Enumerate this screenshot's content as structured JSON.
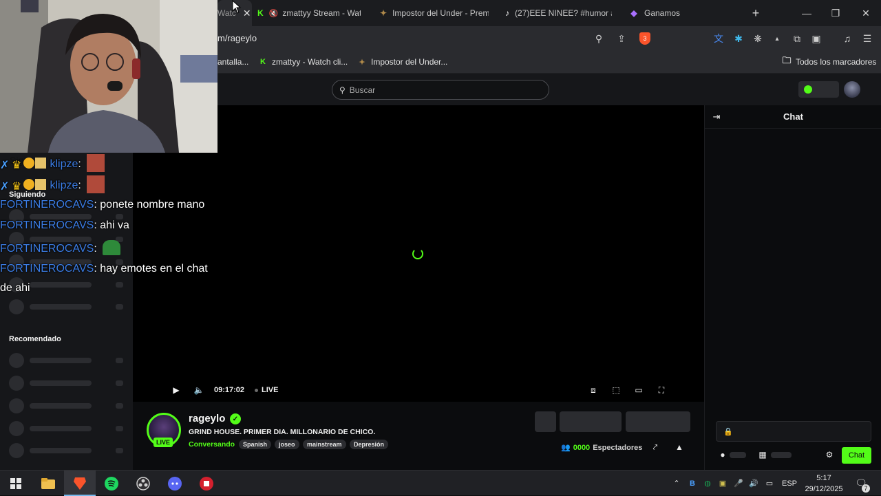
{
  "browser": {
    "tabs": [
      {
        "label": "Watc",
        "icon": "kick-icon"
      },
      {
        "label": "zmattyy Stream - Watc",
        "icon": "kick-icon"
      },
      {
        "label": "Impostor del Under - Prem",
        "icon": "game-icon"
      },
      {
        "label": "(27)EEE NINEE? #humor #",
        "icon": "tiktok-icon"
      },
      {
        "label": "Ganamos",
        "icon": "twitch-icon"
      }
    ],
    "new_tab": "+",
    "url": "m/rageylo",
    "bookmarks": [
      {
        "label": "antalla...",
        "icon": "page-icon"
      },
      {
        "label": "zmattyy - Watch cli...",
        "icon": "kick-icon"
      },
      {
        "label": "Impostor del Under...",
        "icon": "game-icon"
      }
    ],
    "all_bookmarks": "Todos los marcadores",
    "brave_badge": "3"
  },
  "kick": {
    "search_placeholder": "Buscar",
    "sidebar": {
      "following_heading": "Siguiendo",
      "recommended_heading": "Recomendado"
    },
    "player": {
      "time": "09:17:02",
      "live_label": "LIVE"
    },
    "channel": {
      "name": "rageylo",
      "live_badge": "LIVE",
      "title": "GRIND HOUSE. PRIMER DIA. MILLONARIO DE CHICO.",
      "category": "Conversando",
      "tags": [
        "Spanish",
        "joseo",
        "mainstream",
        "Depresión"
      ],
      "viewers": "0000",
      "viewers_label": "Espectadores"
    },
    "chat": {
      "title": "Chat",
      "send_label": "Chat"
    }
  },
  "overlay_chat": [
    {
      "user": "klipze",
      "sep": ":",
      "text": "",
      "has_emote": true
    },
    {
      "user": "klipze",
      "sep": ":",
      "text": "",
      "has_emote": true
    },
    {
      "user": "FORTINEROCAVS",
      "sep": ":",
      "text": " ponete nombre mano"
    },
    {
      "user": "FORTINEROCAVS",
      "sep": ":",
      "text": " ahi va"
    },
    {
      "user": "FORTINEROCAVS",
      "sep": ":",
      "text": "",
      "has_emote": true
    },
    {
      "user": "FORTINEROCAVS",
      "sep": ":",
      "text": " hay emotes en el chat"
    },
    {
      "user": "",
      "sep": "",
      "text": "de ahi"
    }
  ],
  "overlay_partial": "Sigue",
  "taskbar": {
    "apps": [
      "start-icon",
      "file-explorer-icon",
      "brave-icon",
      "spotify-icon",
      "obs-icon",
      "discord-icon",
      "app-icon"
    ],
    "language": "ESP",
    "time": "5:17",
    "date": "29/12/2025",
    "notifications": "7"
  },
  "colors": {
    "kick_green": "#53fc18",
    "username_blue": "#3b7de6",
    "page_bg": "#0b0c0e",
    "panel_bg": "#16171a"
  }
}
